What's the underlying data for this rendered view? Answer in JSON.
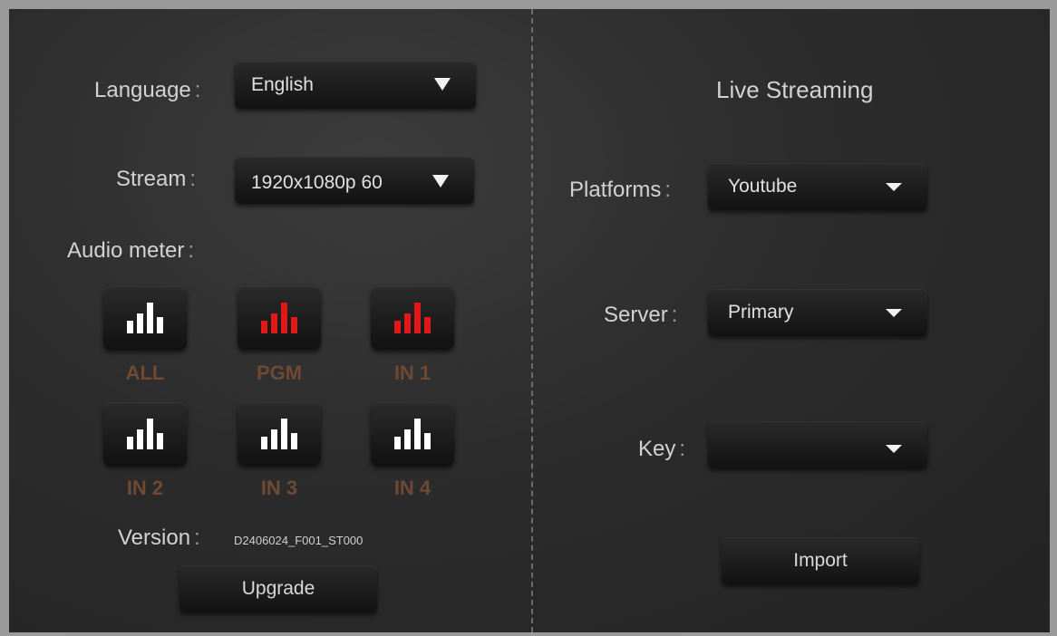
{
  "left": {
    "language": {
      "label": "Language",
      "colon": ":",
      "value": "English"
    },
    "stream": {
      "label": "Stream",
      "colon": ":",
      "value": "1920x1080p 60"
    },
    "audio_meter": {
      "label": "Audio meter",
      "colon": ":",
      "buttons": [
        {
          "label": "ALL",
          "active": false,
          "icon": "bar-meter-icon",
          "color": "#ffffff"
        },
        {
          "label": "PGM",
          "active": true,
          "icon": "bar-meter-icon",
          "color": "#e01818"
        },
        {
          "label": "IN 1",
          "active": true,
          "icon": "bar-meter-icon",
          "color": "#e01818"
        },
        {
          "label": "IN 2",
          "active": false,
          "icon": "bar-meter-icon",
          "color": "#ffffff"
        },
        {
          "label": "IN 3",
          "active": false,
          "icon": "bar-meter-icon",
          "color": "#ffffff"
        },
        {
          "label": "IN 4",
          "active": false,
          "icon": "bar-meter-icon",
          "color": "#ffffff"
        }
      ]
    },
    "version": {
      "label": "Version",
      "colon": ":",
      "value": "D2406024_F001_ST000"
    },
    "upgrade_label": "Upgrade"
  },
  "right": {
    "title": "Live Streaming",
    "platforms": {
      "label": "Platforms",
      "colon": ":",
      "value": "Youtube"
    },
    "server": {
      "label": "Server",
      "colon": ":",
      "value": "Primary"
    },
    "key": {
      "label": "Key",
      "colon": ":",
      "value": ""
    },
    "import_label": "Import"
  },
  "colors": {
    "active_meter": "#e01818",
    "inactive_meter": "#ffffff",
    "meter_label": "#6e4a34"
  }
}
